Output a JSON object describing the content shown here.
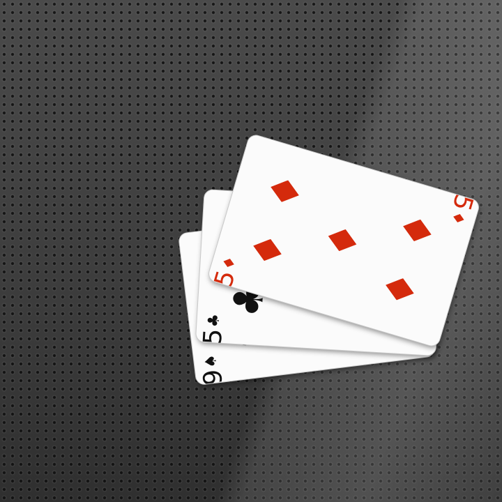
{
  "table": {
    "background_color": "#3c3c3c"
  },
  "cards": [
    {
      "rank": "9",
      "suit": "spades",
      "suit_glyph": "♠",
      "color": "#111111"
    },
    {
      "rank": "5",
      "suit": "clubs",
      "suit_glyph": "♣",
      "color": "#111111"
    },
    {
      "rank": "5",
      "suit": "diamonds",
      "suit_glyph": "♦",
      "color": "#d42a0c"
    }
  ]
}
